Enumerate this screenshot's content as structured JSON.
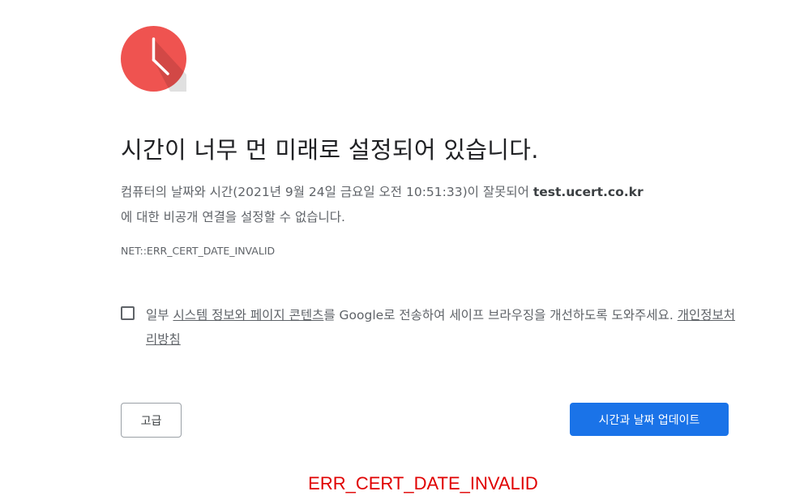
{
  "icon": {
    "name": "clock-icon",
    "color": "#ef5350",
    "hand_color": "#ffffff"
  },
  "heading": "시간이 너무 먼 미래로 설정되어 있습니다.",
  "explanation": {
    "prefix": "컴퓨터의 날짜와 시간(2021년 9월 24일 금요일 오전 10:51:33)이 잘못되어 ",
    "host": "test.ucert.co.kr",
    "suffix": "에 대한 비공개 연결을 설정할 수 없습니다."
  },
  "error_code": "NET::ERR_CERT_DATE_INVALID",
  "optin": {
    "checked": false,
    "text_1": "일부 ",
    "link_1": "시스템 정보와 페이지 콘텐츠",
    "text_2": "를 Google로 전송하여 세이프 브라우징을 개선하도록 도와주세요. ",
    "link_2": "개인정보처리방침"
  },
  "buttons": {
    "advanced": "고급",
    "update": "시간과 날짜 업데이트"
  },
  "colors": {
    "primary_button": "#1a73e8",
    "footer_error": "#e00000"
  },
  "footer_error": "ERR_CERT_DATE_INVALID"
}
